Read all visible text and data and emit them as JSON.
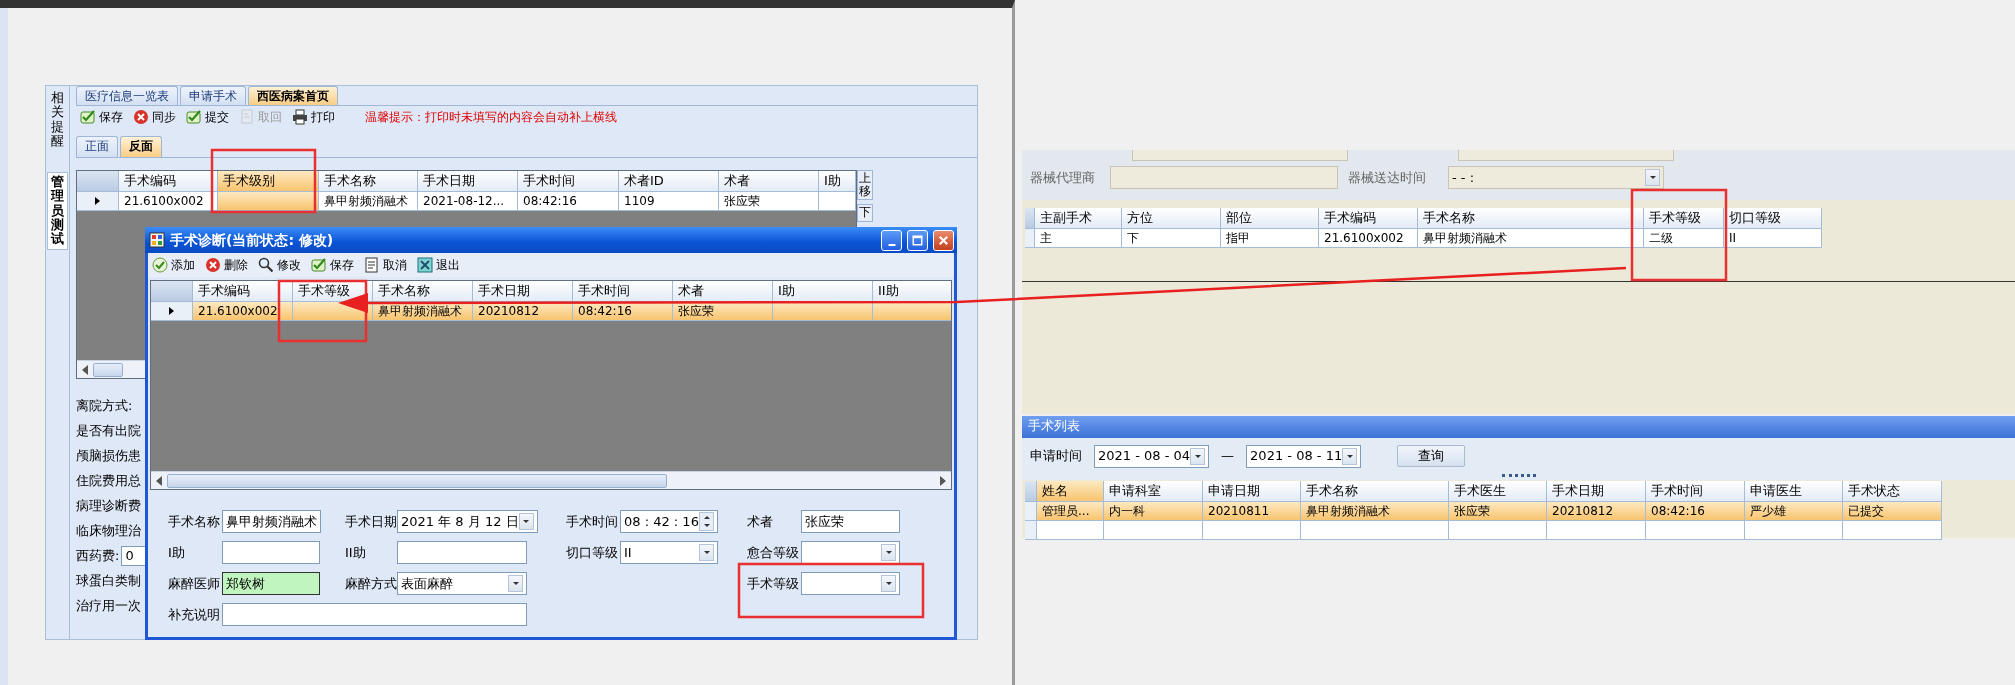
{
  "main_window": {
    "side_tabs": [
      {
        "label": "相关提醒",
        "selected": false
      },
      {
        "label": "管理员测试",
        "selected": true
      }
    ],
    "tabs": [
      {
        "label": "医疗信息一览表",
        "selected": false
      },
      {
        "label": "申请手术",
        "selected": false
      },
      {
        "label": "西医病案首页",
        "selected": true
      }
    ],
    "toolbar": [
      {
        "label": "保存",
        "disabled": false
      },
      {
        "label": "同步",
        "disabled": false
      },
      {
        "label": "提交",
        "disabled": false
      },
      {
        "label": "取回",
        "disabled": true
      },
      {
        "label": "打印",
        "disabled": false
      }
    ],
    "hint": "温馨提示：打印时未填写的内容会自动补上横线",
    "sub_tabs": [
      {
        "label": "正面",
        "selected": false
      },
      {
        "label": "反面",
        "selected": true
      }
    ],
    "table": {
      "columns": [
        {
          "label": "手术编码",
          "selected": false
        },
        {
          "label": "手术级别",
          "selected": true
        },
        {
          "label": "手术名称",
          "selected": false
        },
        {
          "label": "手术日期",
          "selected": false
        },
        {
          "label": "手术时间",
          "selected": false
        },
        {
          "label": "术者ID",
          "selected": false
        },
        {
          "label": "术者",
          "selected": false
        },
        {
          "label": "I助",
          "selected": false
        }
      ],
      "rows": [
        {
          "current": true,
          "selected": false,
          "cells": [
            "21.6100x002",
            null,
            "鼻甲射频消融术",
            "2021-08-12...",
            "08:42:16",
            "1109",
            "张应荣",
            null
          ]
        }
      ]
    },
    "side_buttons": [
      "上移",
      "下"
    ],
    "form": [
      {
        "label": "离院方式:"
      },
      {
        "label": "是否有出院"
      },
      {
        "label": "颅脑损伤患"
      },
      {
        "label": "住院费用总"
      },
      {
        "label": "病理诊断费"
      },
      {
        "label": "临床物理治"
      },
      {
        "label": "西药费:",
        "value": "0"
      },
      {
        "label": "球蛋白类制"
      },
      {
        "label": "治疗用一次"
      }
    ]
  },
  "dialog": {
    "title": "手术诊断(当前状态: 修改)",
    "toolbar": [
      "添加",
      "删除",
      "修改",
      "保存",
      "取消",
      "退出"
    ],
    "table": {
      "columns": [
        {
          "label": "手术编码",
          "selected": false
        },
        {
          "label": "手术等级",
          "selected": false
        },
        {
          "label": "手术名称",
          "selected": false
        },
        {
          "label": "手术日期",
          "selected": false
        },
        {
          "label": "手术时间",
          "selected": false
        },
        {
          "label": "术者",
          "selected": false
        },
        {
          "label": "I助",
          "selected": false
        },
        {
          "label": "II助",
          "selected": false
        }
      ],
      "rows": [
        {
          "current": true,
          "selected": true,
          "cells": [
            "21.6100x002",
            null,
            "鼻甲射频消融术",
            "20210812",
            "08:42:16",
            "张应荣",
            null,
            null
          ]
        }
      ]
    },
    "form": [
      [
        {
          "kind": "text",
          "label": "手术名称",
          "value": "鼻甲射频消融术",
          "highlighted": false
        },
        {
          "kind": "date",
          "label": "手术日期",
          "value": "2021 年 8 月 12 日",
          "highlighted": false
        },
        {
          "kind": "time",
          "label": "手术时间",
          "value": "08 : 42 : 16",
          "highlighted": false
        },
        {
          "kind": "text",
          "label": "术者",
          "value": "张应荣",
          "highlighted": false
        }
      ],
      [
        {
          "kind": "text",
          "label": "I助",
          "highlighted": false
        },
        {
          "kind": "text",
          "label": "II助",
          "highlighted": false
        },
        {
          "kind": "combo",
          "label": "切口等级",
          "value": "II",
          "highlighted": false
        },
        {
          "kind": "combo",
          "label": "愈合等级",
          "highlighted": false
        }
      ],
      [
        {
          "kind": "text",
          "label": "麻醉医师",
          "value": "郑钦树",
          "highlighted": true
        },
        {
          "kind": "combo",
          "label": "麻醉方式",
          "value": "表面麻醉",
          "highlighted": false
        },
        {
          "kind": "blank"
        },
        {
          "kind": "combo",
          "label": "手术等级",
          "highlighted": false
        }
      ],
      [
        {
          "kind": "memo",
          "label": "补充说明",
          "highlighted": false
        }
      ]
    ]
  },
  "device_panel": {
    "field_rows": [
      [
        {
          "kind": "text"
        },
        {
          "kind": "text"
        }
      ],
      [
        {
          "kind": "text",
          "label": "器械代理商"
        },
        {
          "kind": "combo",
          "label": "器械送达时间",
          "value": "-   -        :"
        }
      ]
    ],
    "table": {
      "columns": [
        {
          "label": "主副手术",
          "selected": false
        },
        {
          "label": "方位",
          "selected": false
        },
        {
          "label": "部位",
          "selected": false
        },
        {
          "label": "手术编码",
          "selected": false
        },
        {
          "label": "手术名称",
          "selected": false
        },
        {
          "label": "手术等级",
          "selected": false
        },
        {
          "label": "切口等级",
          "selected": false
        }
      ],
      "rows": [
        {
          "selected": false,
          "cells": [
            "主",
            "下",
            "指甲",
            "21.6100x002",
            "鼻甲射频消融术",
            "二级",
            "II"
          ]
        }
      ]
    }
  },
  "surgery_list": {
    "title": "手术列表",
    "query": {
      "label": "申请时间",
      "from": "2021 - 08 - 04",
      "separator": "—",
      "to": "2021 - 08 - 11",
      "button": "查询"
    },
    "table": {
      "columns": [
        {
          "label": "姓名",
          "selected": true
        },
        {
          "label": "申请科室",
          "selected": false
        },
        {
          "label": "申请日期",
          "selected": false
        },
        {
          "label": "手术名称",
          "selected": false
        },
        {
          "label": "手术医生",
          "selected": false
        },
        {
          "label": "手术日期",
          "selected": false
        },
        {
          "label": "手术时间",
          "selected": false
        },
        {
          "label": "申请医生",
          "selected": false
        },
        {
          "label": "手术状态",
          "selected": false
        }
      ],
      "rows": [
        {
          "selected": true,
          "cells": [
            "管理员...",
            "内一科",
            "20210811",
            "鼻甲射频消融术",
            "张应荣",
            "20210812",
            "08:42:16",
            "严少雄",
            "已提交"
          ]
        }
      ]
    }
  }
}
